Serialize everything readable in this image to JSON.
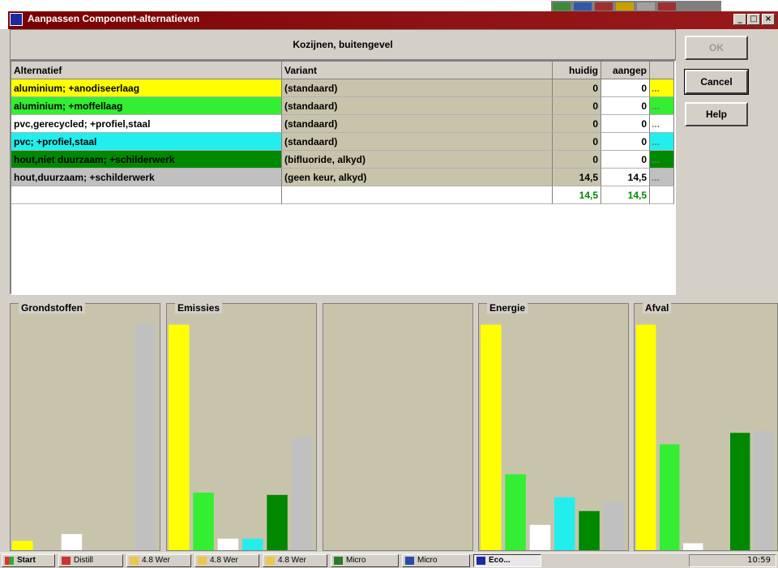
{
  "window": {
    "title": "Aanpassen Component-alternatieven",
    "minimize": "_",
    "maximize": "□",
    "close": "×"
  },
  "header": {
    "title": "Kozijnen, buitengevel"
  },
  "table": {
    "columns": [
      "Alternatief",
      "Variant",
      "huidig",
      "aangep"
    ],
    "rows": [
      {
        "alt": "aluminium; +anodiseerlaag",
        "variant": "(standaard)",
        "huidig": "0",
        "aangep": "0",
        "dots": "...",
        "color": "#ffff00",
        "textColor": "#000000"
      },
      {
        "alt": "aluminium; +moffellaag",
        "variant": "(standaard)",
        "huidig": "0",
        "aangep": "0",
        "dots": "...",
        "color": "#33ee33",
        "textColor": "#000000"
      },
      {
        "alt": "pvc,gerecycled; +profiel,staal",
        "variant": "(standaard)",
        "huidig": "0",
        "aangep": "0",
        "dots": "...",
        "color": "#ffffff",
        "textColor": "#000000"
      },
      {
        "alt": "pvc; +profiel,staal",
        "variant": "(standaard)",
        "huidig": "0",
        "aangep": "0",
        "dots": "...",
        "color": "#22eeee",
        "textColor": "#000000"
      },
      {
        "alt": "hout,niet duurzaam; +schilderwerk",
        "variant": "(bifluoride, alkyd)",
        "huidig": "0",
        "aangep": "0",
        "dots": "...",
        "color": "#008800",
        "textColor": "#000000"
      },
      {
        "alt": "hout,duurzaam; +schilderwerk",
        "variant": "(geen keur, alkyd)",
        "huidig": "14,5",
        "aangep": "14,5",
        "dots": "...",
        "color": "#c0c0c0",
        "textColor": "#000000"
      }
    ],
    "totals": {
      "huidig": "14,5",
      "aangep": "14,5",
      "color": "#008800"
    }
  },
  "buttons": {
    "ok": "OK",
    "cancel": "Cancel",
    "help": "Help"
  },
  "charts": [
    {
      "title": "Grondstoffen",
      "values": [
        0.04,
        0,
        0.07,
        0,
        0,
        0.98
      ]
    },
    {
      "title": "Emissies",
      "values": [
        0.98,
        0.25,
        0.05,
        0.05,
        0.24,
        0.49
      ]
    },
    {
      "title": "",
      "values": []
    },
    {
      "title": "Energie",
      "values": [
        0.98,
        0.33,
        0.11,
        0.23,
        0.17,
        0.21
      ]
    },
    {
      "title": "Afval",
      "values": [
        0.98,
        0.46,
        0.03,
        0,
        0.51,
        0.52
      ]
    }
  ],
  "barColors": [
    "#ffff00",
    "#33ee33",
    "#ffffff",
    "#22eeee",
    "#008800",
    "#c0c0c0"
  ],
  "taskbar": {
    "start": "Start",
    "items": [
      "Distill",
      "4.8 Wer",
      "4.8 Wer",
      "4.8 Wer",
      "Micro",
      "Micro",
      "Eco..."
    ],
    "clock": "10:59"
  }
}
